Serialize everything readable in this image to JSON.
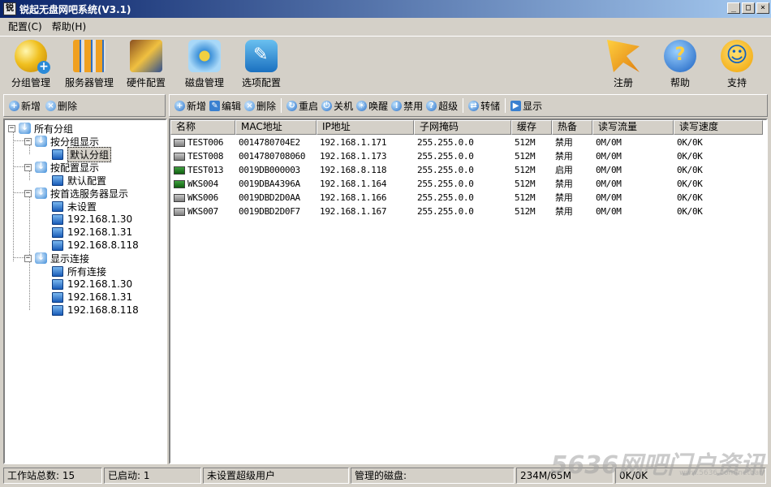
{
  "window": {
    "title": "锐起无盘网吧系统(V3.1)",
    "app_icon_glyph": "锐",
    "controls": {
      "minimize": "_",
      "maximize": "□",
      "close": "×"
    }
  },
  "menu": [
    {
      "label": "配置(C)"
    },
    {
      "label": "帮助(H)"
    }
  ],
  "toolbar": {
    "left": [
      {
        "label": "分组管理",
        "icon": "group-icon"
      },
      {
        "label": "服务器管理",
        "icon": "server-icon"
      },
      {
        "label": "硬件配置",
        "icon": "hardware-icon"
      },
      {
        "label": "磁盘管理",
        "icon": "disk-icon"
      },
      {
        "label": "选项配置",
        "icon": "options-icon"
      }
    ],
    "right": [
      {
        "label": "注册",
        "icon": "register-icon"
      },
      {
        "label": "帮助",
        "icon": "help-icon"
      },
      {
        "label": "支持",
        "icon": "support-icon"
      }
    ]
  },
  "tree_toolbar": {
    "add": "新增",
    "delete": "删除"
  },
  "list_toolbar": {
    "add": "新增",
    "edit": "编辑",
    "delete": "删除",
    "restart": "重启",
    "shutdown": "关机",
    "wake": "唤醒",
    "disable": "禁用",
    "super": "超级",
    "transfer": "转储",
    "show": "显示"
  },
  "tree": {
    "root": "所有分组",
    "by_group": "按分组显示",
    "default_group": "默认分组",
    "by_config": "按配置显示",
    "default_config": "默认配置",
    "by_server": "按首选服务器显示",
    "unset": "未设置",
    "server_ips": [
      "192.168.1.30",
      "192.168.1.31",
      "192.168.8.118"
    ],
    "connections": "显示连接",
    "all_connections": "所有连接",
    "conn_ips": [
      "192.168.1.30",
      "192.168.1.31",
      "192.168.8.118"
    ],
    "expander_open": "−"
  },
  "table": {
    "columns": [
      "名称",
      "MAC地址",
      "IP地址",
      "子网掩码",
      "缓存",
      "热备",
      "读写流量",
      "读写速度"
    ],
    "rows": [
      {
        "name": "TEST006",
        "mac": "0014780704E2",
        "ip": "192.168.1.171",
        "mask": "255.255.0.0",
        "cache": "512M",
        "standby": "禁用",
        "traffic": "0M/0M",
        "speed": "0K/0K",
        "status": "off"
      },
      {
        "name": "TEST008",
        "mac": "0014780708060",
        "ip": "192.168.1.173",
        "mask": "255.255.0.0",
        "cache": "512M",
        "standby": "禁用",
        "traffic": "0M/0M",
        "speed": "0K/0K",
        "status": "off"
      },
      {
        "name": "TEST013",
        "mac": "0019DB000003",
        "ip": "192.168.8.118",
        "mask": "255.255.0.0",
        "cache": "512M",
        "standby": "启用",
        "traffic": "0M/0M",
        "speed": "0K/0K",
        "status": "on"
      },
      {
        "name": "WKS004",
        "mac": "0019DBA4396A",
        "ip": "192.168.1.164",
        "mask": "255.255.0.0",
        "cache": "512M",
        "standby": "禁用",
        "traffic": "0M/0M",
        "speed": "0K/0K",
        "status": "on"
      },
      {
        "name": "WKS006",
        "mac": "0019DBD2D0AA",
        "ip": "192.168.1.166",
        "mask": "255.255.0.0",
        "cache": "512M",
        "standby": "禁用",
        "traffic": "0M/0M",
        "speed": "0K/0K",
        "status": "off"
      },
      {
        "name": "WKS007",
        "mac": "0019DBD2D0F7",
        "ip": "192.168.1.167",
        "mask": "255.255.0.0",
        "cache": "512M",
        "standby": "禁用",
        "traffic": "0M/0M",
        "speed": "0K/0K",
        "status": "off"
      }
    ]
  },
  "status": {
    "workstations": "工作站总数: 15",
    "started": "已启动: 1",
    "super_user": "未设置超级用户",
    "managed_disk": "管理的磁盘:",
    "memory": "234M/65M",
    "rate": "0K/0K"
  },
  "watermark": {
    "brand": "5636网吧门户资讯",
    "url": "www.5636.com/netbar/"
  }
}
